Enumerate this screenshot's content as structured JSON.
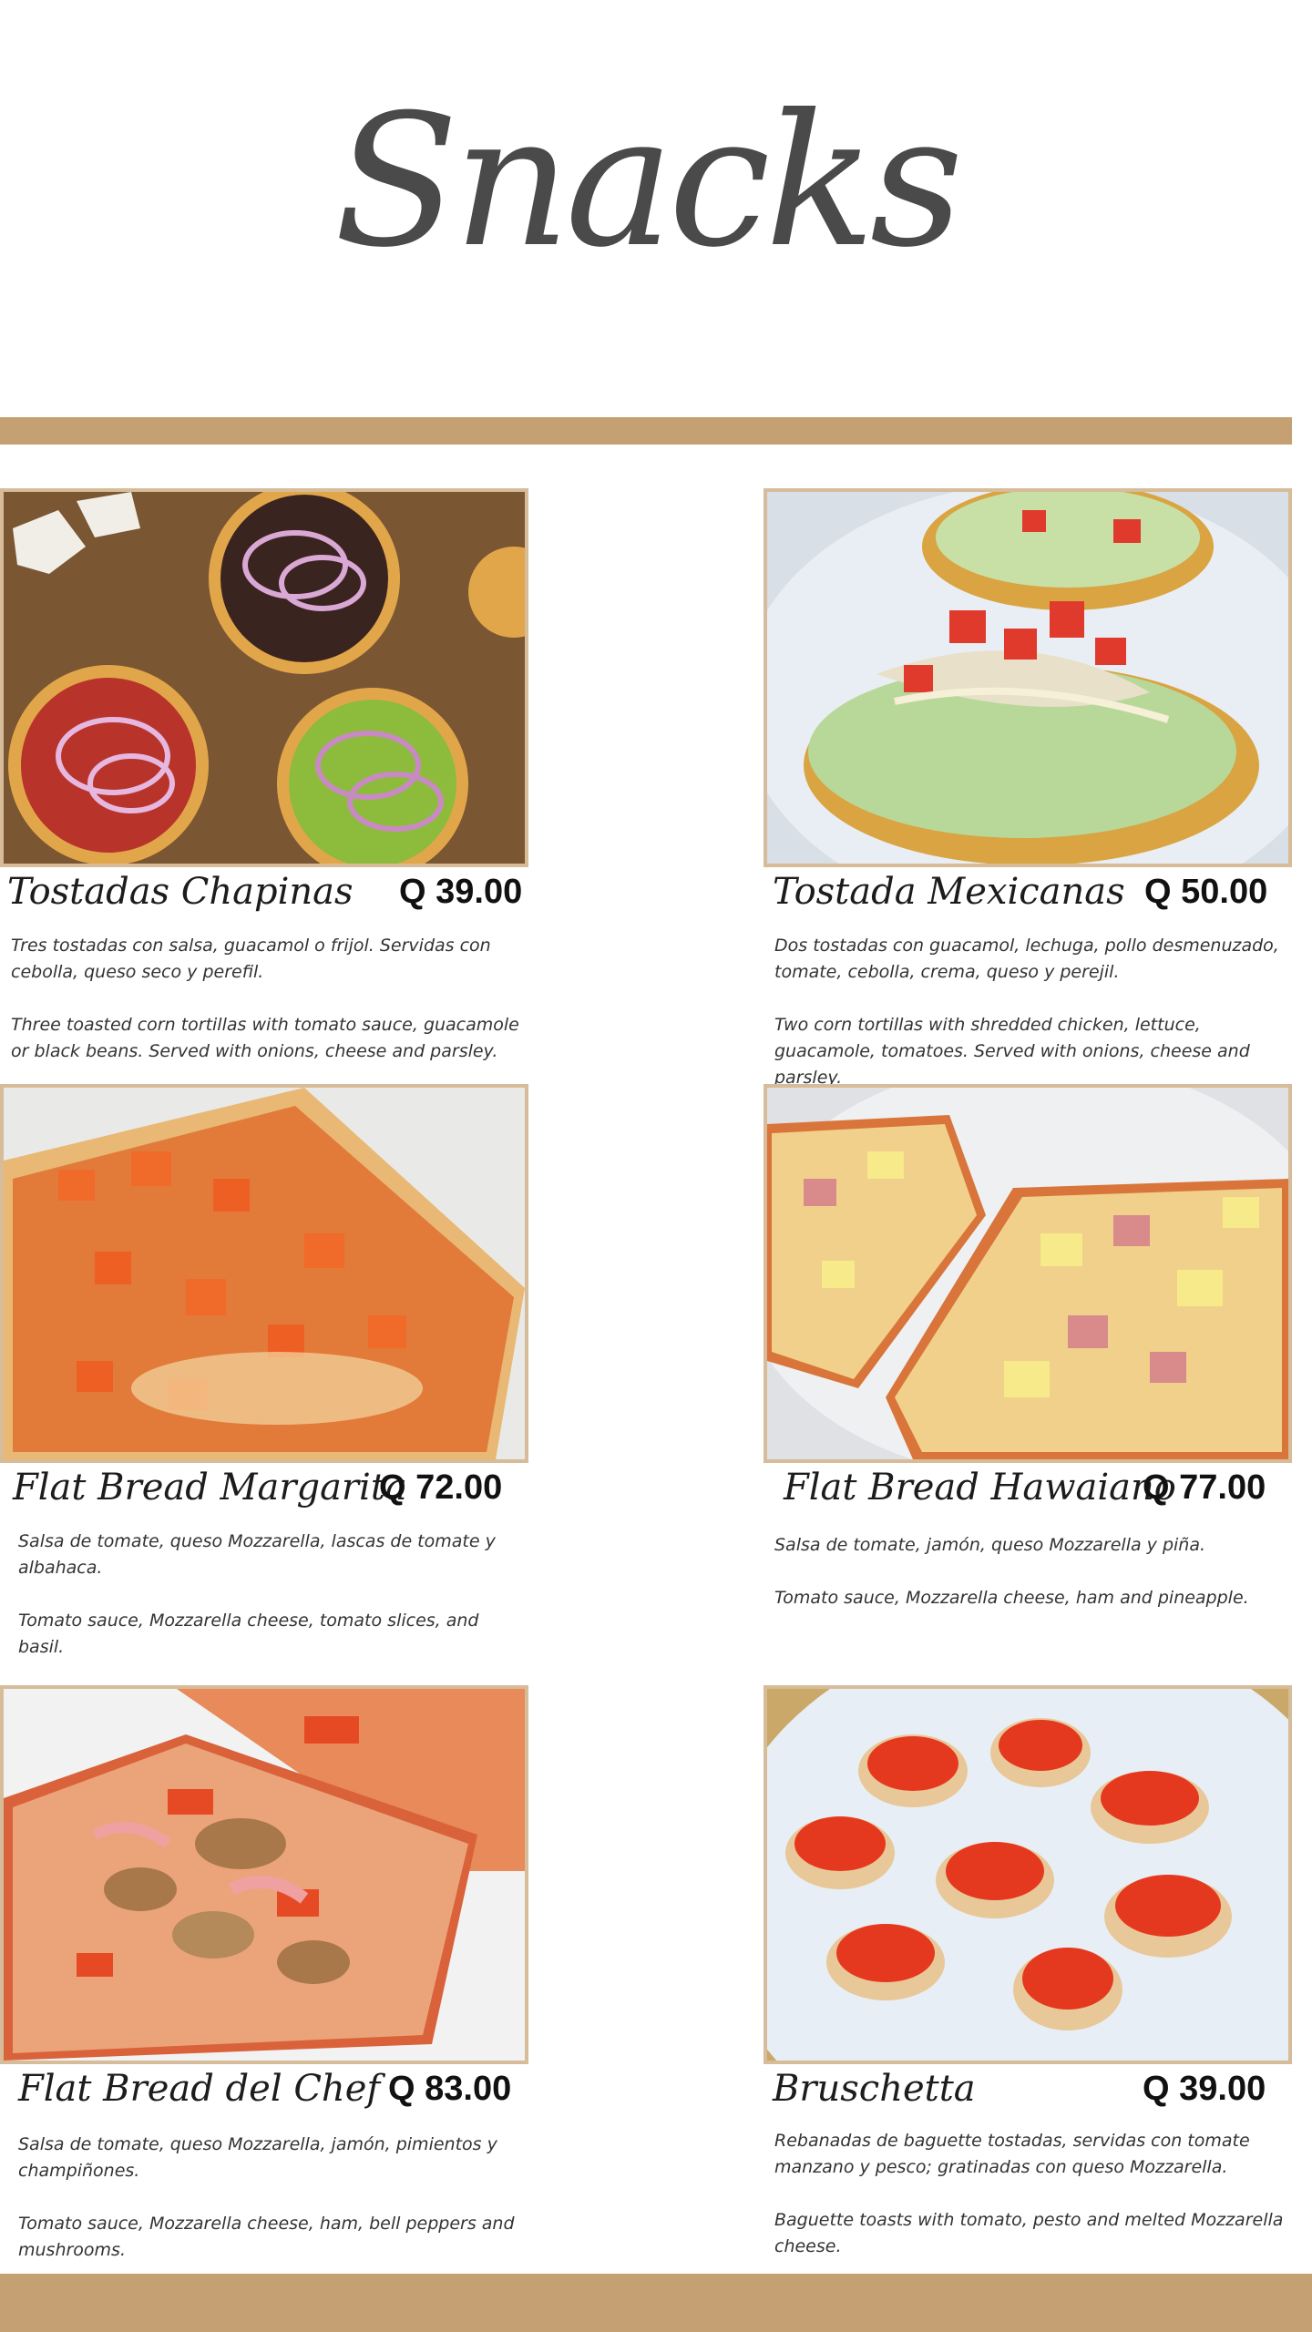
{
  "page": {
    "title": "Snacks",
    "accent_color": "#c4a073",
    "frame_color": "#d6bc98"
  },
  "items": [
    {
      "name": "Tostadas Chapinas",
      "price": "Q 39.00",
      "desc_es": "Tres tostadas con salsa, guacamol o frijol. Servidas con cebolla, queso seco y perefil.",
      "desc_en": "Three toasted corn tortillas with tomato sauce, guacamole or black beans. Served with onions, cheese and parsley.",
      "photo": "tostadas-chapinas-photo"
    },
    {
      "name": "Tostada Mexicanas",
      "price": "Q 50.00",
      "desc_es": "Dos tostadas con guacamol, lechuga, pollo desmenuzado, tomate, cebolla, crema, queso y perejil.",
      "desc_en": "Two corn tortillas with shredded chicken, lettuce, guacamole, tomatoes. Served with onions, cheese and parsley.",
      "photo": "tostada-mexicanas-photo"
    },
    {
      "name": "Flat Bread Margarita",
      "price": "Q 72.00",
      "desc_es": "Salsa de tomate, queso Mozzarella, lascas de tomate y albahaca.",
      "desc_en": "Tomato sauce, Mozzarella cheese, tomato slices, and basil.",
      "photo": "flat-bread-margarita-photo"
    },
    {
      "name": "Flat Bread Hawaiano",
      "price": "Q 77.00",
      "desc_es": "Salsa de tomate, jamón, queso Mozzarella y piña.",
      "desc_en": "Tomato sauce, Mozzarella cheese, ham and pineapple.",
      "photo": "flat-bread-hawaiano-photo"
    },
    {
      "name": "Flat Bread del Chef",
      "price": "Q 83.00",
      "desc_es": "Salsa de tomate, queso Mozzarella, jamón, pimientos y champiñones.",
      "desc_en": "Tomato sauce, Mozzarella cheese, ham, bell peppers and mushrooms.",
      "photo": "flat-bread-del-chef-photo"
    },
    {
      "name": "Bruschetta",
      "price": "Q 39.00",
      "desc_es": "Rebanadas de baguette tostadas, servidas con tomate manzano y pesco; gratinadas con queso Mozzarella.",
      "desc_en": "Baguette toasts with tomato, pesto and melted Mozzarella cheese.",
      "photo": "bruschetta-photo"
    }
  ]
}
